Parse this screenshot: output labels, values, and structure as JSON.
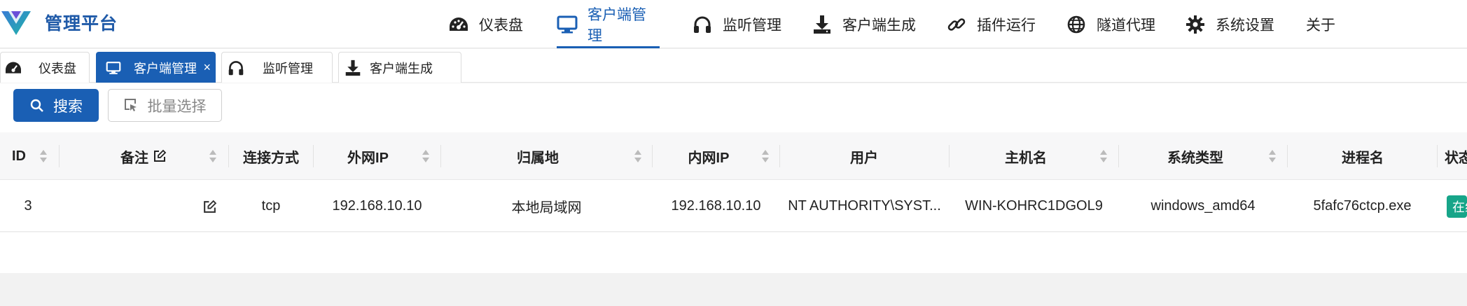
{
  "header": {
    "brand_title": "管理平台",
    "nav": [
      {
        "label": "仪表盘",
        "icon": "dashboard-icon"
      },
      {
        "label": "客户端管理",
        "icon": "monitor-icon",
        "active": true
      },
      {
        "label": "监听管理",
        "icon": "headphones-icon"
      },
      {
        "label": "客户端生成",
        "icon": "download-icon"
      },
      {
        "label": "插件运行",
        "icon": "link-icon"
      },
      {
        "label": "隧道代理",
        "icon": "globe-icon"
      },
      {
        "label": "系统设置",
        "icon": "gear-icon"
      },
      {
        "label": "关于",
        "icon": ""
      }
    ],
    "accent_color": "#1a5fb4"
  },
  "tabs": [
    {
      "label": "仪表盘",
      "icon": "dashboard-icon"
    },
    {
      "label": "客户端管理",
      "icon": "monitor-icon",
      "active": true,
      "close": "×"
    },
    {
      "label": "监听管理",
      "icon": "headphones-icon"
    },
    {
      "label": "客户端生成",
      "icon": "download-icon"
    }
  ],
  "toolbar": {
    "search_label": "搜索",
    "batch_select_label": "批量选择"
  },
  "table": {
    "columns": [
      "ID",
      "备注",
      "连接方式",
      "外网IP",
      "归属地",
      "内网IP",
      "用户",
      "主机名",
      "系统类型",
      "进程名",
      "状态"
    ],
    "rows": [
      {
        "id": "3",
        "remark": "",
        "conn": "tcp",
        "wan_ip": "192.168.10.10",
        "location": "本地局域网",
        "lan_ip": "192.168.10.10",
        "user": "NT AUTHORITY\\SYST...",
        "hostname": "WIN-KOHRC1DGOL9",
        "os": "windows_amd64",
        "process": "5fafc76ctcp.exe",
        "status": "在线",
        "status_color": "#17a589"
      }
    ]
  }
}
